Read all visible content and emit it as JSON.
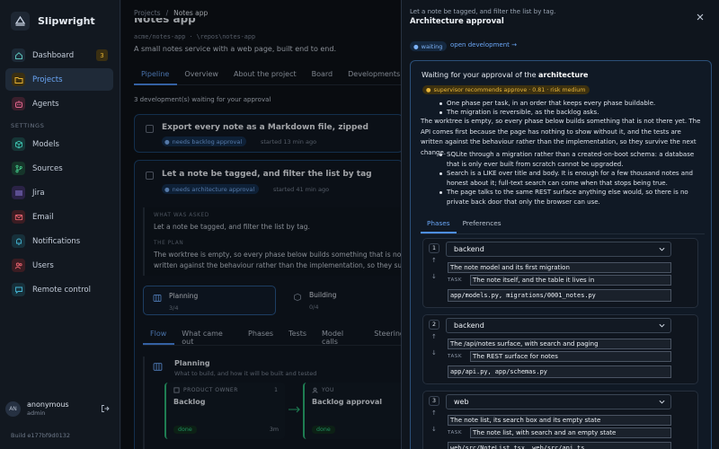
{
  "sidebar": {
    "brand": "Slipwright",
    "items": [
      {
        "label": "Dashboard",
        "icon": "home-icon",
        "badge": "3"
      },
      {
        "label": "Projects",
        "icon": "folder-icon",
        "active": true
      },
      {
        "label": "Agents",
        "icon": "bot-icon"
      }
    ],
    "section_label": "SETTINGS",
    "settings_items": [
      {
        "label": "Models",
        "icon": "cube-icon"
      },
      {
        "label": "Sources",
        "icon": "git-branch-icon"
      },
      {
        "label": "Jira",
        "icon": "jira-icon"
      },
      {
        "label": "Email",
        "icon": "mail-icon"
      },
      {
        "label": "Notifications",
        "icon": "bell-icon"
      },
      {
        "label": "Users",
        "icon": "users-icon"
      },
      {
        "label": "Remote control",
        "icon": "chat-icon"
      }
    ],
    "user": {
      "initials": "AN",
      "name": "anonymous",
      "role": "admin"
    },
    "build": "Build e177bf9d0132"
  },
  "main": {
    "breadcrumb": [
      "Projects",
      "/",
      "Notes app"
    ],
    "title": "Notes app",
    "repo": "acme/notes-app · \\repos\\notes-app",
    "description": "A small notes service with a web page, built end to end.",
    "tabs": [
      "Pipeline",
      "Overview",
      "About the project",
      "Board",
      "Developments"
    ],
    "waiting_count": "3 development(s) waiting for your approval",
    "dev1": {
      "title": "Export every note as a Markdown file, zipped",
      "badge": "needs backlog approval",
      "started": "started 13 min ago"
    },
    "dev2": {
      "title": "Let a note be tagged, and filter the list by tag",
      "badge": "needs architecture approval",
      "started": "started 41 min ago",
      "asked_label": "WHAT WAS ASKED",
      "asked": "Let a note be tagged, and filter the list by tag.",
      "plan_label": "THE PLAN",
      "plan_1": "The worktree is empty, so every phase below builds something that is not there yet.",
      "plan_2": "written against the behaviour rather than the implementation, so they survive the next change.",
      "phases": [
        {
          "name": "Planning",
          "count": "3/4"
        },
        {
          "name": "Building",
          "count": "0/4"
        }
      ],
      "flow_tabs": [
        "Flow",
        "What came out",
        "Phases",
        "Tests",
        "Model calls",
        "Steering"
      ],
      "flow_title": "Planning",
      "flow_sub": "What to build, and how it will be built and tested",
      "steps": [
        {
          "role": "PRODUCT OWNER",
          "name": "Backlog",
          "status": "done",
          "num": "1",
          "time": "3m"
        },
        {
          "role": "YOU",
          "name": "Backlog approval",
          "status": "done"
        }
      ]
    }
  },
  "drawer": {
    "subtitle": "Let a note be tagged, and filter the list by tag.",
    "title": "Architecture approval",
    "status": "waiting",
    "link": "open development →",
    "panel": {
      "heading_pre": "Waiting for your approval of the",
      "heading_bold": "architecture",
      "recommend": "supervisor recommends approve · 0.81 · risk medium",
      "bullets_1": [
        "One phase per task, in an order that keeps every phase buildable.",
        "The migration is reversible, as the backlog asks."
      ],
      "paragraph": "The worktree is empty, so every phase below builds something that is not there yet. The API comes first because the page has nothing to show without it, and the tests are written against the behaviour rather than the implementation, so they survive the next change.",
      "bullets_2": [
        "SQLite through a migration rather than a created-on-boot schema: a database that is only ever built from scratch cannot be upgraded.",
        "Search is a LIKE over title and body. It is enough for a few thousand notes and honest about it; full-text search can come when that stops being true.",
        "The page talks to the same REST surface anything else would, so there is no private back door that only the browser can use."
      ],
      "tabs": [
        "Phases",
        "Preferences"
      ],
      "task_label": "TASK",
      "phases": [
        {
          "num": "1",
          "kind": "backend",
          "title": "The note model and its first migration",
          "task": "The note itself, and the table it lives in",
          "files": "app/models.py, migrations/0001_notes.py"
        },
        {
          "num": "2",
          "kind": "backend",
          "title": "The /api/notes surface, with search and paging",
          "task": "The REST surface for notes",
          "files": "app/api.py, app/schemas.py"
        },
        {
          "num": "3",
          "kind": "web",
          "title": "The note list, its search box and its empty state",
          "task": "The note list, with search and an empty state",
          "files": "web/src/NoteList.tsx, web/src/api.ts"
        }
      ]
    }
  },
  "colors": {
    "accent": "#4d8ff0",
    "success": "#2ed08a",
    "warning": "#e5b233",
    "background": "#0e1219"
  }
}
